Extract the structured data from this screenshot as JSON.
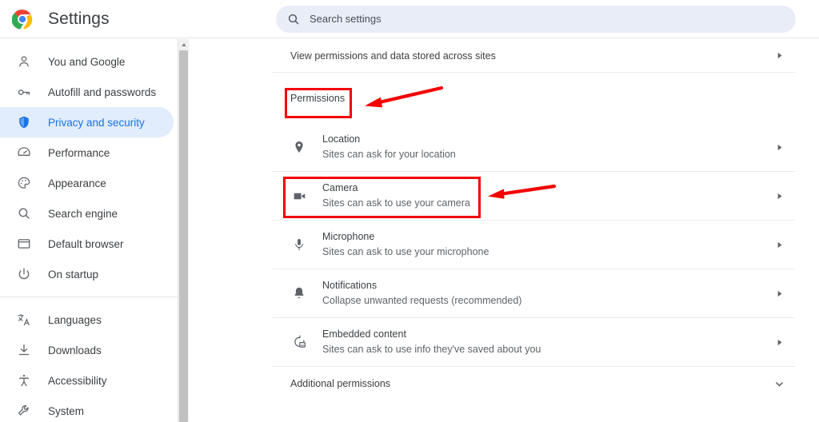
{
  "window": {
    "app_title": "Settings",
    "logo_icon": "chrome-logo-icon"
  },
  "search": {
    "placeholder": "Search settings",
    "value": "",
    "icon": "search-icon"
  },
  "sidebar": {
    "groups": [
      {
        "items": [
          {
            "label": "You and Google",
            "icon": "person-icon",
            "selected": false
          },
          {
            "label": "Autofill and passwords",
            "icon": "key-icon",
            "selected": false
          },
          {
            "label": "Privacy and security",
            "icon": "shield-icon",
            "selected": true
          },
          {
            "label": "Performance",
            "icon": "speedometer-icon",
            "selected": false
          },
          {
            "label": "Appearance",
            "icon": "palette-icon",
            "selected": false
          },
          {
            "label": "Search engine",
            "icon": "magnifier-icon",
            "selected": false
          },
          {
            "label": "Default browser",
            "icon": "browser-window-icon",
            "selected": false
          },
          {
            "label": "On startup",
            "icon": "power-icon",
            "selected": false
          }
        ]
      },
      {
        "items": [
          {
            "label": "Languages",
            "icon": "translate-icon",
            "selected": false
          },
          {
            "label": "Downloads",
            "icon": "download-icon",
            "selected": false
          },
          {
            "label": "Accessibility",
            "icon": "accessibility-icon",
            "selected": false
          },
          {
            "label": "System",
            "icon": "wrench-icon",
            "selected": false
          }
        ]
      }
    ],
    "scrollbar": {
      "up_arrow_icon": "scroll-up-arrow-icon"
    }
  },
  "main": {
    "top_row": {
      "label": "View permissions and data stored across sites",
      "chevron": "chevron-right-icon"
    },
    "permissions_heading": "Permissions",
    "permission_rows": [
      {
        "title": "Location",
        "subtitle": "Sites can ask for your location",
        "icon": "location-pin-icon",
        "chevron": "chevron-right-icon"
      },
      {
        "title": "Camera",
        "subtitle": "Sites can ask to use your camera",
        "icon": "camera-icon",
        "chevron": "chevron-right-icon"
      },
      {
        "title": "Microphone",
        "subtitle": "Sites can ask to use your microphone",
        "icon": "microphone-icon",
        "chevron": "chevron-right-icon"
      },
      {
        "title": "Notifications",
        "subtitle": "Collapse unwanted requests (recommended)",
        "icon": "bell-icon",
        "chevron": "chevron-right-icon"
      },
      {
        "title": "Embedded content",
        "subtitle": "Sites can ask to use info they've saved about you",
        "icon": "embedded-content-icon",
        "chevron": "chevron-right-icon"
      }
    ],
    "additional_permissions": {
      "label": "Additional permissions",
      "chevron": "chevron-down-icon"
    }
  },
  "annotations": {
    "color": "#f40000",
    "boxes": [
      {
        "name": "permissions-highlight",
        "target": "Permissions"
      },
      {
        "name": "camera-highlight",
        "target": "Camera"
      }
    ],
    "arrows": [
      {
        "name": "permissions-arrow",
        "points_to": "Permissions"
      },
      {
        "name": "camera-arrow",
        "points_to": "Camera"
      }
    ]
  },
  "colors": {
    "accent": "#1a73e8",
    "selected_bg": "#e1ecfd",
    "search_bg": "#e9edf7",
    "annotation_red": "#f40000",
    "text_primary": "#3c4043",
    "text_secondary": "#5f6368"
  }
}
